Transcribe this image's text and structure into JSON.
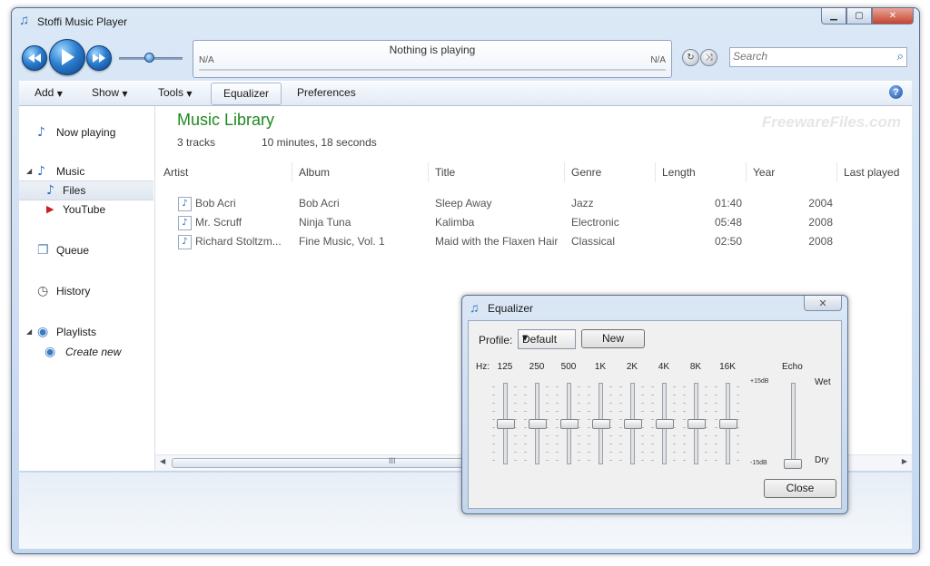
{
  "window": {
    "title": "Stoffi Music Player"
  },
  "player": {
    "left_time": "N/A",
    "right_time": "N/A",
    "now_playing": "Nothing is playing",
    "volume_fraction": 0.45
  },
  "search": {
    "placeholder": "Search"
  },
  "menu": {
    "add": "Add",
    "show": "Show",
    "tools": "Tools",
    "equalizer": "Equalizer",
    "preferences": "Preferences"
  },
  "nav": {
    "now_playing": "Now playing",
    "music": "Music",
    "files": "Files",
    "youtube": "YouTube",
    "queue": "Queue",
    "history": "History",
    "playlists": "Playlists",
    "create_new": "Create new"
  },
  "library": {
    "title": "Music Library",
    "track_count": "3 tracks",
    "duration": "10 minutes, 18 seconds",
    "watermark": "FreewareFiles.com",
    "columns": [
      "Artist",
      "Album",
      "Title",
      "Genre",
      "Length",
      "Year",
      "Last played"
    ],
    "tracks": [
      {
        "artist": "Bob Acri",
        "album": "Bob Acri",
        "title": "Sleep Away",
        "genre": "Jazz",
        "length": "01:40",
        "year": "2004"
      },
      {
        "artist": "Mr. Scruff",
        "album": "Ninja Tuna",
        "title": "Kalimba",
        "genre": "Electronic",
        "length": "05:48",
        "year": "2008"
      },
      {
        "artist": "Richard Stoltzm...",
        "album": "Fine Music, Vol. 1",
        "title": "Maid with the Flaxen Hair",
        "genre": "Classical",
        "length": "02:50",
        "year": "2008"
      }
    ],
    "scroll_grip": "III"
  },
  "equalizer": {
    "title": "Equalizer",
    "close_x": "✕",
    "profile_label": "Profile:",
    "profile_value": "Default",
    "new_button": "New",
    "hz_label": "Hz:",
    "bands": [
      "125",
      "250",
      "500",
      "1K",
      "2K",
      "4K",
      "8K",
      "16K"
    ],
    "band_levels_db": [
      0,
      0,
      0,
      0,
      0,
      0,
      0,
      0
    ],
    "plus_label": "+15dB",
    "minus_label": "-15dB",
    "echo_label": "Echo",
    "wet_label": "Wet",
    "dry_label": "Dry",
    "echo_level": 0,
    "close_button": "Close"
  }
}
